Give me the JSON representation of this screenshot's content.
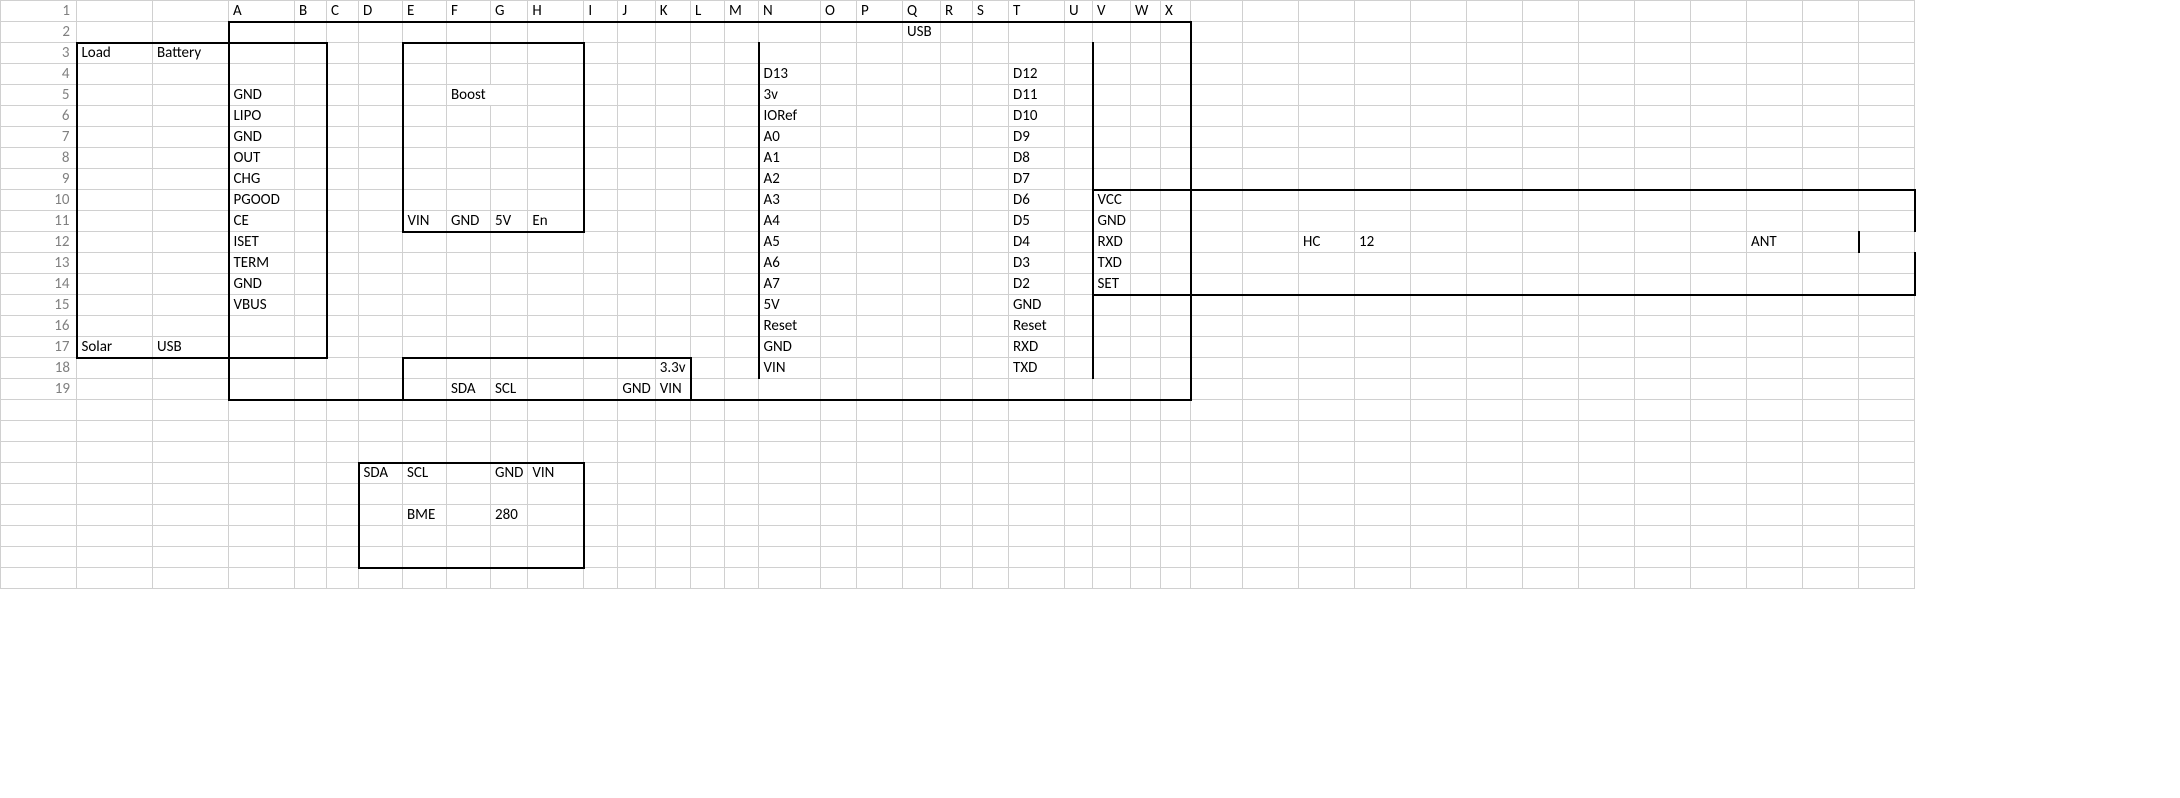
{
  "rowNumbers": [
    "1",
    "2",
    "3",
    "4",
    "5",
    "6",
    "7",
    "8",
    "9",
    "10",
    "11",
    "12",
    "13",
    "14",
    "15",
    "16",
    "17",
    "18",
    "19"
  ],
  "colHeaders": {
    "4": "A",
    "5": "B",
    "6": "C",
    "7": "D",
    "8": "E",
    "9": "F",
    "10": "G",
    "11": "H",
    "12": "I",
    "13": "J",
    "14": "K",
    "15": "L",
    "16": "M",
    "17": "N",
    "18": "O",
    "19": "P",
    "20": "Q",
    "21": "R",
    "22": "S",
    "23": "T",
    "24": "U",
    "25": "V",
    "26": "W",
    "27": "X"
  },
  "labels": {
    "load": "Load",
    "battery": "Battery",
    "solar": "Solar",
    "usb_lower": "USB",
    "gnd": "GND",
    "lipo": "LIPO",
    "out": "OUT",
    "chg": "CHG",
    "pgood": "PGOOD",
    "ce": "CE",
    "iset": "ISET",
    "term": "TERM",
    "vbus": "VBUS",
    "boost": "Boost",
    "vin": "VIN",
    "fiveV": "5V",
    "en": "En",
    "sda": "SDA",
    "scl": "SCL",
    "threeV3": "3.3v",
    "usb": "USB",
    "d13": "D13",
    "threeV": "3v",
    "ioref": "IORef",
    "a0": "A0",
    "a1": "A1",
    "a2": "A2",
    "a3": "A3",
    "a4": "A4",
    "a5": "A5",
    "a6": "A6",
    "a7": "A7",
    "reset": "Reset",
    "d12": "D12",
    "d11": "D11",
    "d10": "D10",
    "d9": "D9",
    "d8": "D8",
    "d7": "D7",
    "d6": "D6",
    "d5": "D5",
    "d4": "D4",
    "d3": "D3",
    "d2": "D2",
    "rxd": "RXD",
    "txd": "TXD",
    "set": "SET",
    "vcc": "VCC",
    "hc": "HC",
    "twelve": "12",
    "ant": "ANT",
    "bme": "BME",
    "n280": "280"
  }
}
